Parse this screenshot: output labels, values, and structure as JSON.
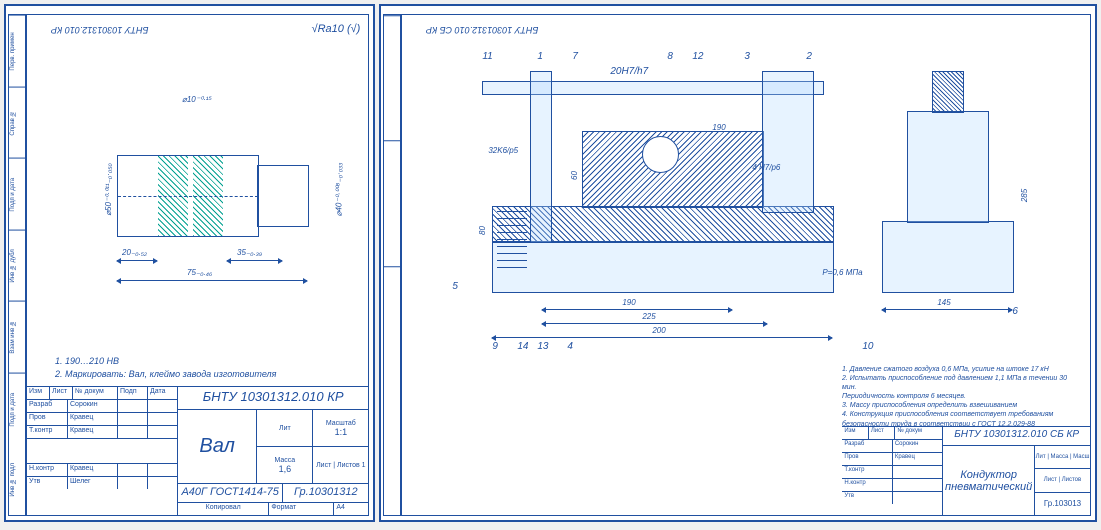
{
  "left_sheet": {
    "code_top": "БНТУ 10301312.010 КР",
    "surface": "√Ra10 (√)",
    "dims": {
      "d10": "⌀10⁻⁰·¹⁵",
      "d50": "⌀50⁻⁰·⁰¹¹₋₀·₀₅₀",
      "d40": "⌀40⁻⁰·⁰⁰⁸₋₀·₀₃₃",
      "l20": "20₋₀.₅₂",
      "l35": "35₋₀.₃₉",
      "l75": "75₋₀.₄₆"
    },
    "notes": {
      "n1": "1. 190…210 HB",
      "n2": "2. Маркировать: Вал, клеймо завода изготовителя"
    },
    "title": {
      "rows": [
        {
          "c1": "Изм",
          "c2": "Лист",
          "c3": "№ докум",
          "c4": "Подп",
          "c5": "Дата"
        },
        {
          "c1": "Разраб",
          "c2": "Сорокин",
          "c3": "",
          "c4": "",
          "c5": ""
        },
        {
          "c1": "Пров",
          "c2": "Кравец",
          "c3": "",
          "c4": "",
          "c5": ""
        },
        {
          "c1": "Т.контр",
          "c2": "Кравец",
          "c3": "",
          "c4": "",
          "c5": ""
        },
        {
          "c1": "Н.контр",
          "c2": "Кравец",
          "c3": "",
          "c4": "",
          "c5": ""
        },
        {
          "c1": "Утв",
          "c2": "Шелег",
          "c3": "",
          "c4": "",
          "c5": ""
        }
      ],
      "header": "БНТУ 10301312.010 КР",
      "name": "Вал",
      "lit": "Лит",
      "mass": "Масса",
      "mass_v": "1,6",
      "scale": "Масштаб",
      "scale_v": "1:1",
      "material": "А40Г ГОСТ1414-75",
      "group": "Гр.10301312",
      "foot1": "Копировал",
      "foot2": "Формат",
      "foot2v": "А4"
    }
  },
  "right_sheet": {
    "code_top": "БНТУ 10301312.010 СБ КР",
    "balloons": [
      "11",
      "1",
      "7",
      "20H7/h7",
      "8",
      "12",
      "3",
      "2",
      "5",
      "9",
      "14",
      "13",
      "4",
      "10",
      "6"
    ],
    "dims": {
      "fit20": "20H7/h7",
      "fit32": "32K6/p5",
      "fit4": "4 H7/p6",
      "d190": "190",
      "d60": "60",
      "d80": "80",
      "h190": "190",
      "h225": "225",
      "h200": "200",
      "h145": "145",
      "v285": "285",
      "p": "P=0,6 МПа"
    },
    "notes": {
      "n1": "1. Давление сжатого воздуха 0,6 МПа, усилие на штоке 17 кН",
      "n2": "2. Испытать приспособление под давлением 1,1 МПа в течении 30 мин.",
      "n3": "   Периодичность контроля 6 месяцев.",
      "n4": "3. Массу приспособления определить взвешиванием",
      "n5": "4. Конструкция приспособления соответствует требованиям",
      "n6": "   безопасности труда в соответствии с ГОСТ 12.2.029-88"
    },
    "title": {
      "header": "БНТУ 10301312.010 СБ КР",
      "name1": "Кондуктор",
      "name2": "пневматический",
      "group": "Гр.103013"
    }
  }
}
